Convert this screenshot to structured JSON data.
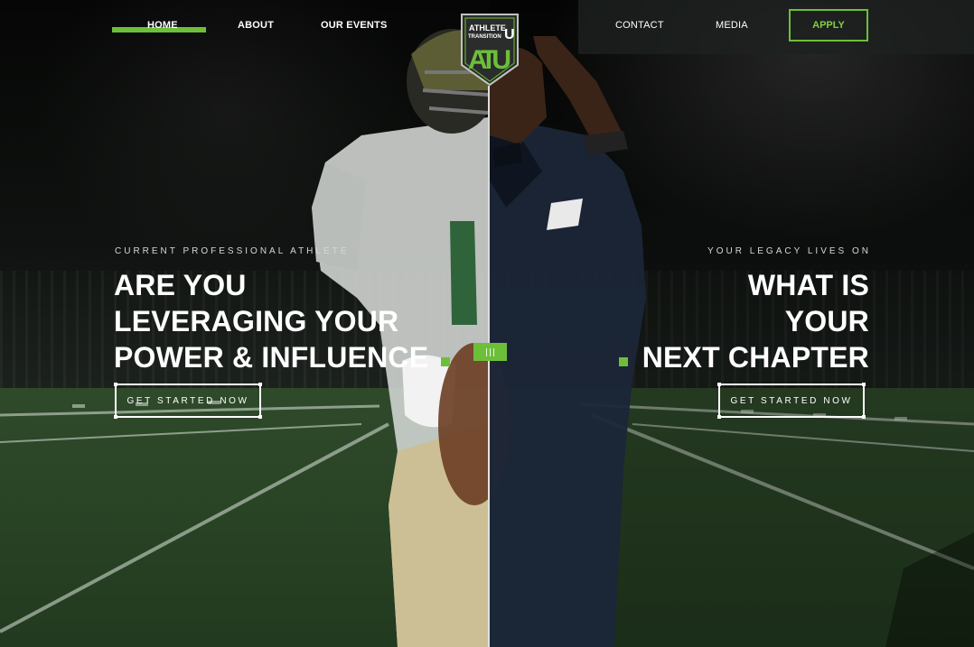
{
  "nav": {
    "items": [
      "HOME",
      "ABOUT",
      "OUR EVENTS",
      "CONTACT",
      "MEDIA"
    ],
    "active": "HOME",
    "apply_label": "APPLY"
  },
  "logo": {
    "line1": "ATHLETE",
    "line2": "TRANSITION",
    "letter_u": "U",
    "monogram": "ATU"
  },
  "left": {
    "eyebrow": "CURRENT PROFESSIONAL ATHLETE",
    "headline": [
      "ARE YOU",
      "LEVERAGING YOUR",
      "POWER & INFLUENCE"
    ],
    "cta": "GET STARTED NOW"
  },
  "right": {
    "eyebrow": "YOUR LEGACY LIVES ON",
    "headline": [
      "WHAT IS",
      "YOUR",
      "NEXT CHAPTER"
    ],
    "cta": "GET STARTED NOW"
  },
  "colors": {
    "accent": "#6dbf3a",
    "text": "#ffffff"
  },
  "icons": {
    "logo": "atu-shield-logo",
    "slider_handle": "comparison-slider-handle-icon"
  }
}
